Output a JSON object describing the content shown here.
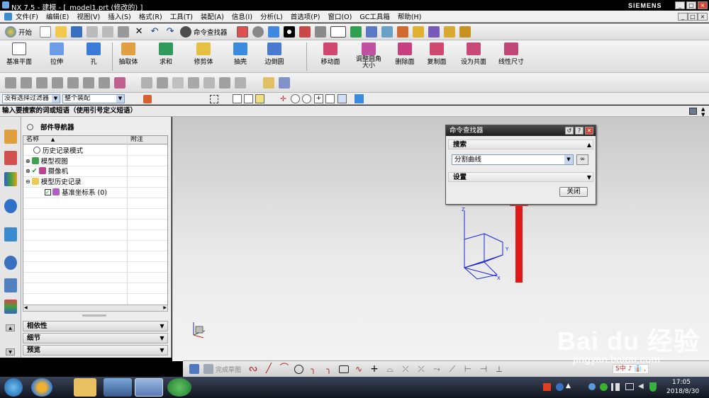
{
  "window": {
    "title": "NX 7.5 - 建模 - [_model1.prt  (修改的) ]",
    "brand": "SIEMENS",
    "controls": [
      "_",
      "□",
      "×"
    ]
  },
  "menubar": {
    "items": [
      "文件(F)",
      "编辑(E)",
      "视图(V)",
      "插入(S)",
      "格式(R)",
      "工具(T)",
      "装配(A)",
      "信息(I)",
      "分析(L)",
      "首选项(P)",
      "窗口(O)",
      "GC工具箱",
      "帮助(H)"
    ],
    "doc_controls": [
      "_",
      "□",
      "×"
    ]
  },
  "toolbar_standard": {
    "start_label": "开始",
    "command_finder_label": "命令查找器"
  },
  "toolbar_features": {
    "items": [
      {
        "label": "基准平面",
        "icon": "datum-plane-icon"
      },
      {
        "label": "拉伸",
        "icon": "extrude-icon"
      },
      {
        "label": "孔",
        "icon": "hole-icon"
      },
      {
        "label": "抽取体",
        "icon": "extract-body-icon"
      },
      {
        "label": "求和",
        "icon": "unite-icon"
      },
      {
        "label": "修剪体",
        "icon": "trim-body-icon"
      },
      {
        "label": "抽壳",
        "icon": "shell-icon"
      },
      {
        "label": "边倒圆",
        "icon": "edge-blend-icon"
      },
      {
        "label": "移动面",
        "icon": "move-face-icon"
      },
      {
        "label": "调整圆角大小",
        "icon": "resize-blend-icon"
      },
      {
        "label": "删除面",
        "icon": "delete-face-icon"
      },
      {
        "label": "复制面",
        "icon": "copy-face-icon"
      },
      {
        "label": "设为共面",
        "icon": "coplanar-icon"
      },
      {
        "label": "线性尺寸",
        "icon": "linear-dimension-icon"
      }
    ]
  },
  "filter_bar": {
    "type_filter": "没有选择过滤器",
    "scope_filter": "整个装配"
  },
  "hint_bar": {
    "text": "输入要搜索的词或短语（使用引号定义短语）"
  },
  "part_navigator": {
    "title": "部件导航器",
    "col_name": "名称",
    "col_sort": "▲",
    "col_note": "附注",
    "rows": [
      {
        "label": "历史记录模式",
        "indent": 1,
        "toggle": ""
      },
      {
        "label": "模型视图",
        "indent": 0,
        "toggle": "⊕"
      },
      {
        "label": "摄像机",
        "indent": 0,
        "toggle": "⊕"
      },
      {
        "label": "模型历史记录",
        "indent": 0,
        "toggle": "⊖"
      },
      {
        "label": "基准坐标系 (0)",
        "indent": 2,
        "toggle": ""
      }
    ],
    "panels": [
      "相依性",
      "细节",
      "预览"
    ]
  },
  "command_finder_dialog": {
    "title": "命令查找器",
    "search_section": "搜索",
    "search_value": "分割曲线",
    "settings_section": "设置",
    "close_label": "关闭"
  },
  "csys_axes": {
    "z": "Z",
    "y": "Y",
    "x": "X"
  },
  "sketch_bar": {
    "finish_label": "完成草图"
  },
  "taskbar": {
    "time": "17:05",
    "date": "2018/8/30",
    "tray_text": "S中 ♪ 👔 ,"
  },
  "watermark": {
    "brand": "Bai du 经验",
    "url": "jingyan.baidu.com"
  },
  "colors": {
    "arrow": "#e01818",
    "csys": "#1a24d8",
    "title_bg": "#000000"
  }
}
